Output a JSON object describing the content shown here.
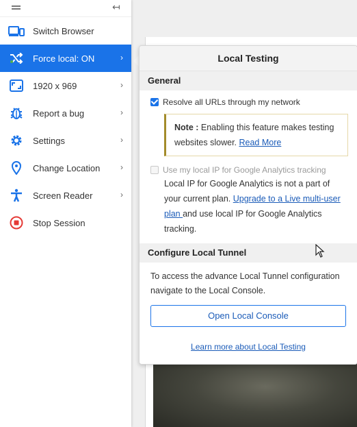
{
  "sidebar": {
    "items": [
      {
        "label": "Switch Browser",
        "icon": "devices-icon"
      },
      {
        "label": "Force local: ON",
        "icon": "shuffle-icon",
        "active": true,
        "has_submenu": true
      },
      {
        "label": "1920 x 969",
        "icon": "resolution-icon",
        "has_submenu": true
      },
      {
        "label": "Report a bug",
        "icon": "bug-icon",
        "has_submenu": true
      },
      {
        "label": "Settings",
        "icon": "gear-icon",
        "has_submenu": true
      },
      {
        "label": "Change Location",
        "icon": "location-pin-icon",
        "has_submenu": true
      },
      {
        "label": "Screen Reader",
        "icon": "accessibility-icon",
        "has_submenu": true
      },
      {
        "label": "Stop Session",
        "icon": "stop-icon"
      }
    ]
  },
  "panel": {
    "title": "Local Testing",
    "general": {
      "heading": "General",
      "resolve_label": "Resolve all URLs through my network",
      "resolve_checked": true,
      "note_prefix": "Note :",
      "note_text": " Enabling this feature makes testing websites slower. ",
      "note_link": "Read More",
      "local_ip_label": "Use my local IP for Google Analytics tracking",
      "local_ip_checked": false,
      "plan_text_1": "Local IP for Google Analytics is not a part of your current plan. ",
      "plan_link": "Upgrade to a Live multi-user plan ",
      "plan_text_2": "and use local IP for Google Analytics tracking."
    },
    "tunnel": {
      "heading": "Configure Local Tunnel",
      "text": "To access the advance Local Tunnel configuration navigate to the Local Console.",
      "button": "Open Local Console",
      "learn_link": "Learn more about Local Testing"
    }
  },
  "colors": {
    "accent": "#1a73e8",
    "note_border": "#a38b2a",
    "stop_red": "#e53935"
  }
}
